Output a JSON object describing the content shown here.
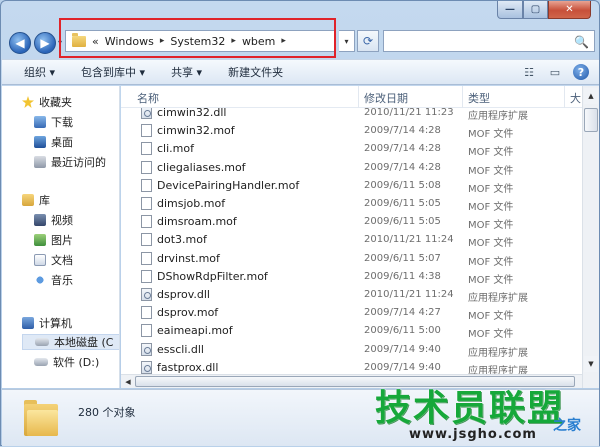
{
  "caption": {
    "minimize": "—",
    "maximize": "▢",
    "close": "✕"
  },
  "nav": {
    "back": "◀",
    "forward": "▶",
    "dropdown": "▾"
  },
  "address": {
    "prefix": "«",
    "crumbs": [
      "Windows",
      "System32",
      "wbem"
    ],
    "separator": "▸",
    "dropdown": "▾",
    "refresh": "⟳"
  },
  "search": {
    "placeholder": "",
    "icon": "🔍"
  },
  "toolbar": {
    "organize": "组织 ▾",
    "include_in_library": "包含到库中 ▾",
    "share": "共享 ▾",
    "new_folder": "新建文件夹",
    "view_icon": "☷",
    "pane_icon": "▭",
    "help": "?"
  },
  "navpane": {
    "favorites": "收藏夹",
    "downloads": "下载",
    "desktop": "桌面",
    "recent": "最近访问的",
    "libraries": "库",
    "videos": "视频",
    "pictures": "图片",
    "documents": "文档",
    "music": "音乐",
    "computer": "计算机",
    "local_disk": "本地磁盘 (C",
    "software": "软件 (D:)"
  },
  "columns": {
    "name": "名称",
    "date": "修改日期",
    "type": "类型",
    "size": "大"
  },
  "files": [
    {
      "name": "cimwin32.dll",
      "date": "2010/11/21 11:23",
      "type": "应用程序扩展",
      "kind": "dll"
    },
    {
      "name": "cimwin32.mof",
      "date": "2009/7/14 4:28",
      "type": "MOF 文件",
      "kind": "mof"
    },
    {
      "name": "cli.mof",
      "date": "2009/7/14 4:28",
      "type": "MOF 文件",
      "kind": "mof"
    },
    {
      "name": "cliegaliases.mof",
      "date": "2009/7/14 4:28",
      "type": "MOF 文件",
      "kind": "mof"
    },
    {
      "name": "DevicePairingHandler.mof",
      "date": "2009/6/11 5:08",
      "type": "MOF 文件",
      "kind": "mof"
    },
    {
      "name": "dimsjob.mof",
      "date": "2009/6/11 5:05",
      "type": "MOF 文件",
      "kind": "mof"
    },
    {
      "name": "dimsroam.mof",
      "date": "2009/6/11 5:05",
      "type": "MOF 文件",
      "kind": "mof"
    },
    {
      "name": "dot3.mof",
      "date": "2010/11/21 11:24",
      "type": "MOF 文件",
      "kind": "mof"
    },
    {
      "name": "drvinst.mof",
      "date": "2009/6/11 5:07",
      "type": "MOF 文件",
      "kind": "mof"
    },
    {
      "name": "DShowRdpFilter.mof",
      "date": "2009/6/11 4:38",
      "type": "MOF 文件",
      "kind": "mof"
    },
    {
      "name": "dsprov.dll",
      "date": "2010/11/21 11:24",
      "type": "应用程序扩展",
      "kind": "dll"
    },
    {
      "name": "dsprov.mof",
      "date": "2009/7/14 4:27",
      "type": "MOF 文件",
      "kind": "mof"
    },
    {
      "name": "eaimeapi.mof",
      "date": "2009/6/11 5:00",
      "type": "MOF 文件",
      "kind": "mof"
    },
    {
      "name": "esscli.dll",
      "date": "2009/7/14 9:40",
      "type": "应用程序扩展",
      "kind": "dll"
    },
    {
      "name": "fastprox.dll",
      "date": "2009/7/14 9:40",
      "type": "应用程序扩展",
      "kind": "dll"
    }
  ],
  "scroll": {
    "up": "▲",
    "down": "▼",
    "left": "◀",
    "right": "▶"
  },
  "status": {
    "count": "280 个对象"
  },
  "watermark": {
    "main": "技术员联盟",
    "sub": "之家",
    "url": "www.jsgho.com"
  }
}
